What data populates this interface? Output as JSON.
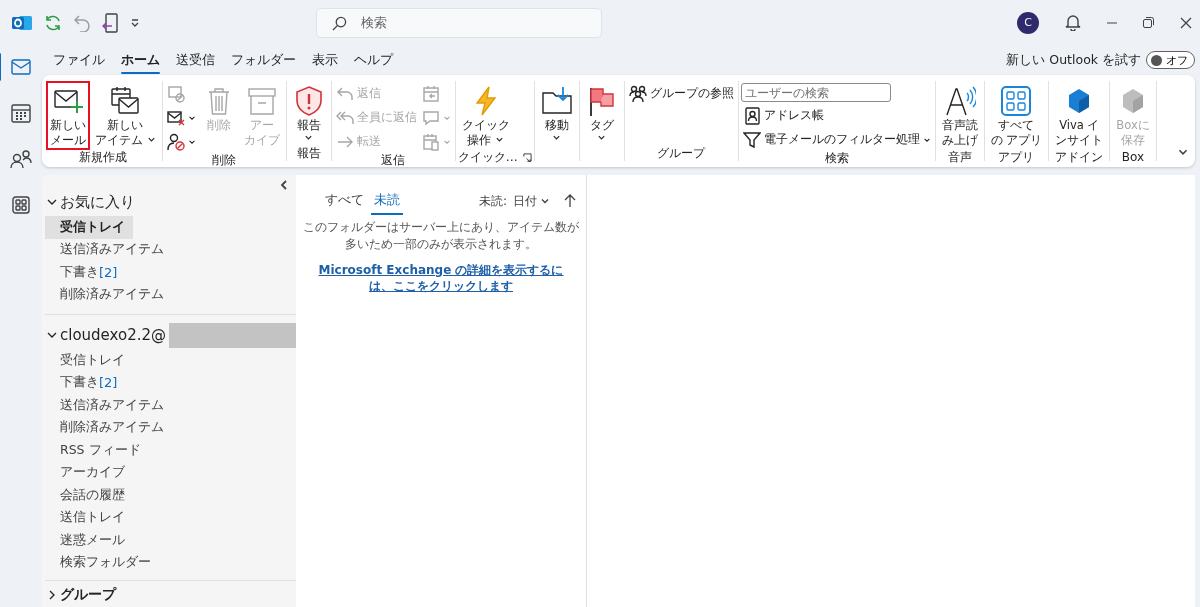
{
  "title_bar": {
    "search": {
      "placeholder": "検索"
    },
    "avatar": "C"
  },
  "rail": [
    {
      "selected": true
    },
    {
      "selected": false
    },
    {
      "selected": false
    },
    {
      "selected": false
    }
  ],
  "menu_tabs": [
    {
      "label": "ファイル",
      "selected": false
    },
    {
      "label": "ホーム",
      "selected": true
    },
    {
      "label": "送受信",
      "selected": false
    },
    {
      "label": "フォルダー",
      "selected": false
    },
    {
      "label": "表示",
      "selected": false
    },
    {
      "label": "ヘルプ",
      "selected": false
    }
  ],
  "new_outlook": {
    "label": "新しい Outlook を試す",
    "toggle": "オフ",
    "on": false
  },
  "ribbon": {
    "groups": [
      {
        "label": "新規作成",
        "items": [
          {
            "kind": "large",
            "label": [
              "新しい",
              "メール"
            ],
            "highlighted": true,
            "disabled": false,
            "dropdown": false
          },
          {
            "kind": "large",
            "label": [
              "新しい",
              "アイテム"
            ],
            "highlighted": false,
            "disabled": false,
            "dropdown": true
          }
        ]
      },
      {
        "label": "削除",
        "items": [
          {
            "kind": "icon",
            "disabled": true,
            "dropdown": false
          },
          {
            "kind": "icon",
            "disabled": false,
            "dropdown": true
          },
          {
            "kind": "icon",
            "disabled": false,
            "dropdown": true
          },
          {
            "kind": "large",
            "label": [
              "削除"
            ],
            "highlighted": false,
            "disabled": true,
            "dropdown": false
          },
          {
            "kind": "large",
            "label": [
              "アー",
              "カイブ"
            ],
            "highlighted": false,
            "disabled": true,
            "dropdown": false
          }
        ]
      },
      {
        "label": "報告",
        "items": [
          {
            "kind": "large",
            "label": [
              "報告"
            ],
            "highlighted": false,
            "disabled": false,
            "dropdown": true
          }
        ]
      },
      {
        "label": "返信",
        "items": [
          {
            "kind": "small",
            "label": "返信",
            "disabled": true,
            "dropdown": false
          },
          {
            "kind": "small",
            "label": "全員に返信",
            "disabled": true,
            "dropdown": false
          },
          {
            "kind": "small",
            "label": "転送",
            "disabled": true,
            "dropdown": false
          },
          {
            "kind": "icon",
            "disabled": true,
            "dropdown": false
          },
          {
            "kind": "icon",
            "disabled": true,
            "dropdown": true
          },
          {
            "kind": "icon",
            "disabled": true,
            "dropdown": true
          }
        ]
      },
      {
        "label": "クイック…",
        "launcher": true,
        "items": [
          {
            "kind": "large",
            "label": [
              "クイック",
              "操作"
            ],
            "highlighted": false,
            "disabled": false,
            "dropdown": true
          }
        ]
      },
      {
        "items": [
          {
            "kind": "large",
            "label": [
              "移動"
            ],
            "highlighted": false,
            "disabled": false,
            "dropdown": true
          }
        ]
      },
      {
        "items": [
          {
            "kind": "large",
            "label": [
              "タグ"
            ],
            "highlighted": false,
            "disabled": false,
            "dropdown": true
          }
        ]
      },
      {
        "label": "グループ",
        "items": [
          {
            "kind": "small",
            "label": "グループの参照",
            "disabled": false,
            "dropdown": false
          }
        ]
      },
      {
        "label": "検索",
        "items": [
          {
            "kind": "field",
            "placeholder": "ユーザーの検索"
          },
          {
            "kind": "small",
            "label": "アドレス帳",
            "disabled": false,
            "dropdown": false
          },
          {
            "kind": "small",
            "label": "電子メールのフィルター処理",
            "disabled": false,
            "dropdown": true
          }
        ]
      },
      {
        "label": "音声",
        "items": [
          {
            "kind": "large",
            "label": [
              "音声読",
              "み上げ"
            ],
            "highlighted": false,
            "disabled": false,
            "dropdown": false
          }
        ]
      },
      {
        "label": "アプリ",
        "items": [
          {
            "kind": "large",
            "label": [
              "すべて",
              "の アプリ"
            ],
            "highlighted": false,
            "disabled": false,
            "dropdown": false
          }
        ]
      },
      {
        "label": "アドイン",
        "items": [
          {
            "kind": "large",
            "label": [
              "Viva イ",
              "ンサイト"
            ],
            "highlighted": false,
            "disabled": false,
            "dropdown": false
          }
        ]
      },
      {
        "label": "Box",
        "items": [
          {
            "kind": "large",
            "label": [
              "Boxに",
              "保存"
            ],
            "highlighted": false,
            "disabled": true,
            "dropdown": false
          }
        ]
      }
    ]
  },
  "folder_pane": {
    "sections": [
      {
        "kind": "favorites",
        "title": "お気に入り",
        "expanded": true,
        "items": [
          {
            "label": "受信トレイ",
            "selected": true
          },
          {
            "label": "送信済みアイテム",
            "selected": false
          },
          {
            "label": "下書き",
            "count": "[2]",
            "selected": false
          },
          {
            "label": "削除済みアイテム",
            "selected": false
          }
        ]
      },
      {
        "kind": "account",
        "title": "cloudexo2.2@",
        "redacted": true,
        "expanded": true,
        "items": [
          {
            "label": "受信トレイ",
            "selected": false
          },
          {
            "label": "下書き",
            "count": "[2]",
            "selected": false
          },
          {
            "label": "送信済みアイテム",
            "selected": false
          },
          {
            "label": "削除済みアイテム",
            "selected": false
          },
          {
            "label": "RSS フィード",
            "selected": false
          },
          {
            "label": "アーカイブ",
            "selected": false
          },
          {
            "label": "会話の履歴",
            "selected": false
          },
          {
            "label": "送信トレイ",
            "selected": false
          },
          {
            "label": "迷惑メール",
            "selected": false
          },
          {
            "label": "検索フォルダー",
            "selected": false
          }
        ]
      },
      {
        "kind": "groups",
        "title": "グループ",
        "expanded": false
      }
    ]
  },
  "message_list": {
    "tabs": [
      {
        "label": "すべて",
        "selected": false
      },
      {
        "label": "未読",
        "selected": true
      }
    ],
    "filter_label": "未読:",
    "sort": "日付",
    "notice": "このフォルダーはサーバー上にあり、アイテム数が多いため一部のみが表示されます。",
    "link": "Microsoft Exchange の詳細を表示するには、ここをクリックします"
  }
}
